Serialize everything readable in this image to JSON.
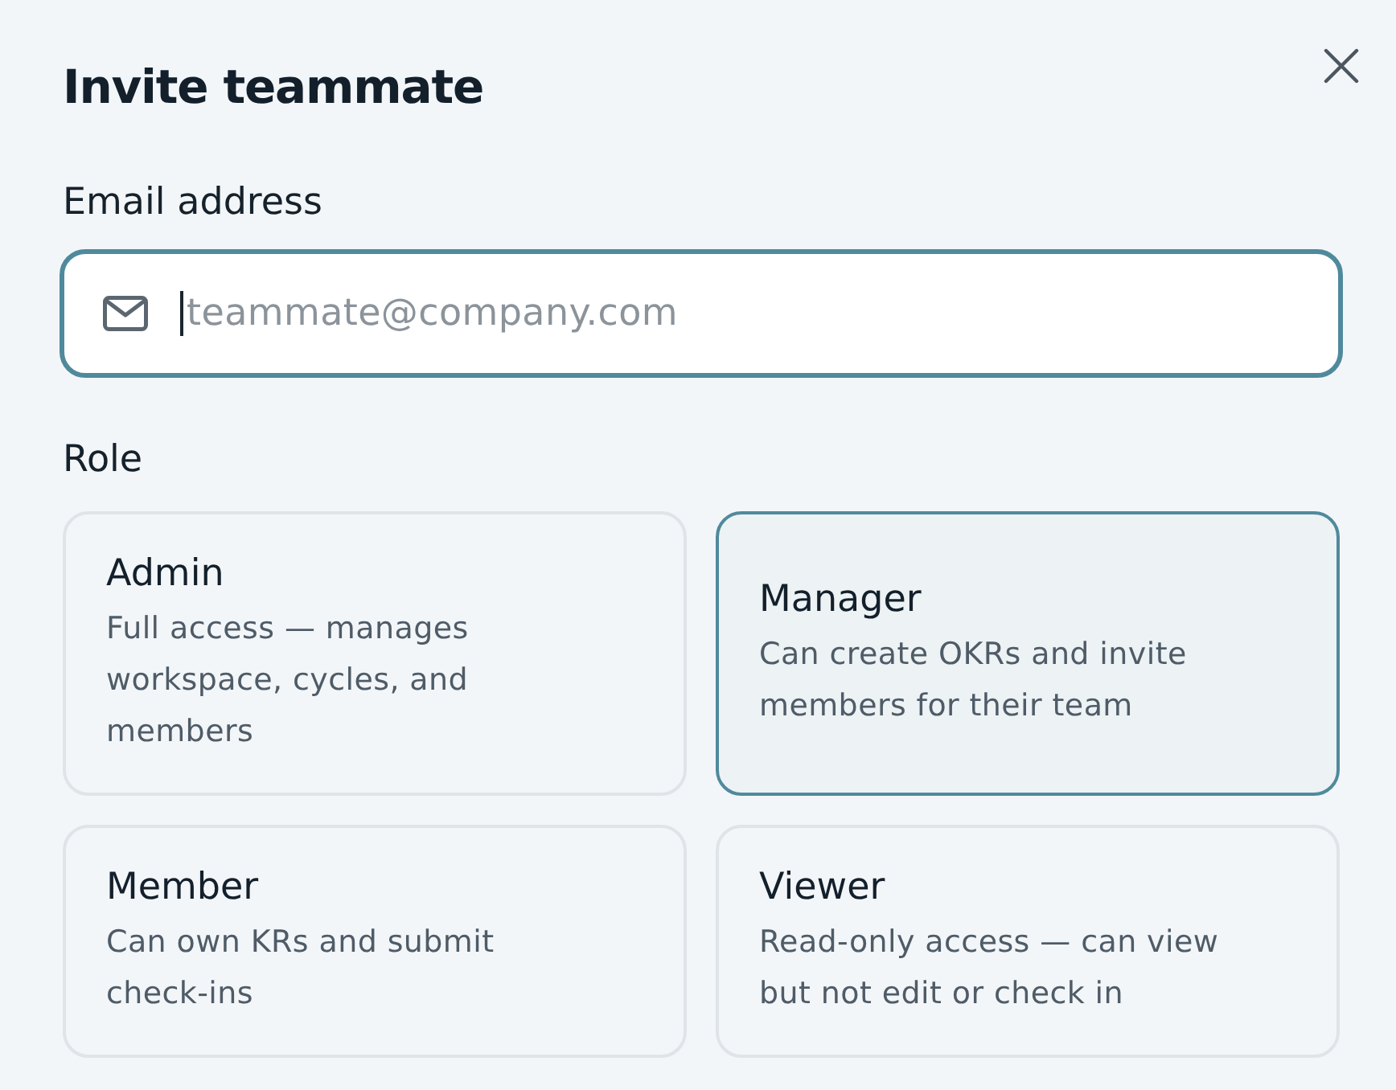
{
  "dialog": {
    "title": "Invite teammate"
  },
  "email_field": {
    "label": "Email address",
    "placeholder": "teammate@company.com",
    "focused": true
  },
  "role": {
    "label": "Role",
    "options": [
      {
        "title": "Admin",
        "description": "Full access — manages workspace, cycles, and members",
        "selected": false
      },
      {
        "title": "Manager",
        "description": "Can create OKRs and invite members for their team",
        "selected": true
      },
      {
        "title": "Member",
        "description": "Can own KRs and submit check-ins",
        "selected": false
      },
      {
        "title": "Viewer",
        "description": "Read-only access — can view but not edit or check in",
        "selected": false
      }
    ]
  }
}
